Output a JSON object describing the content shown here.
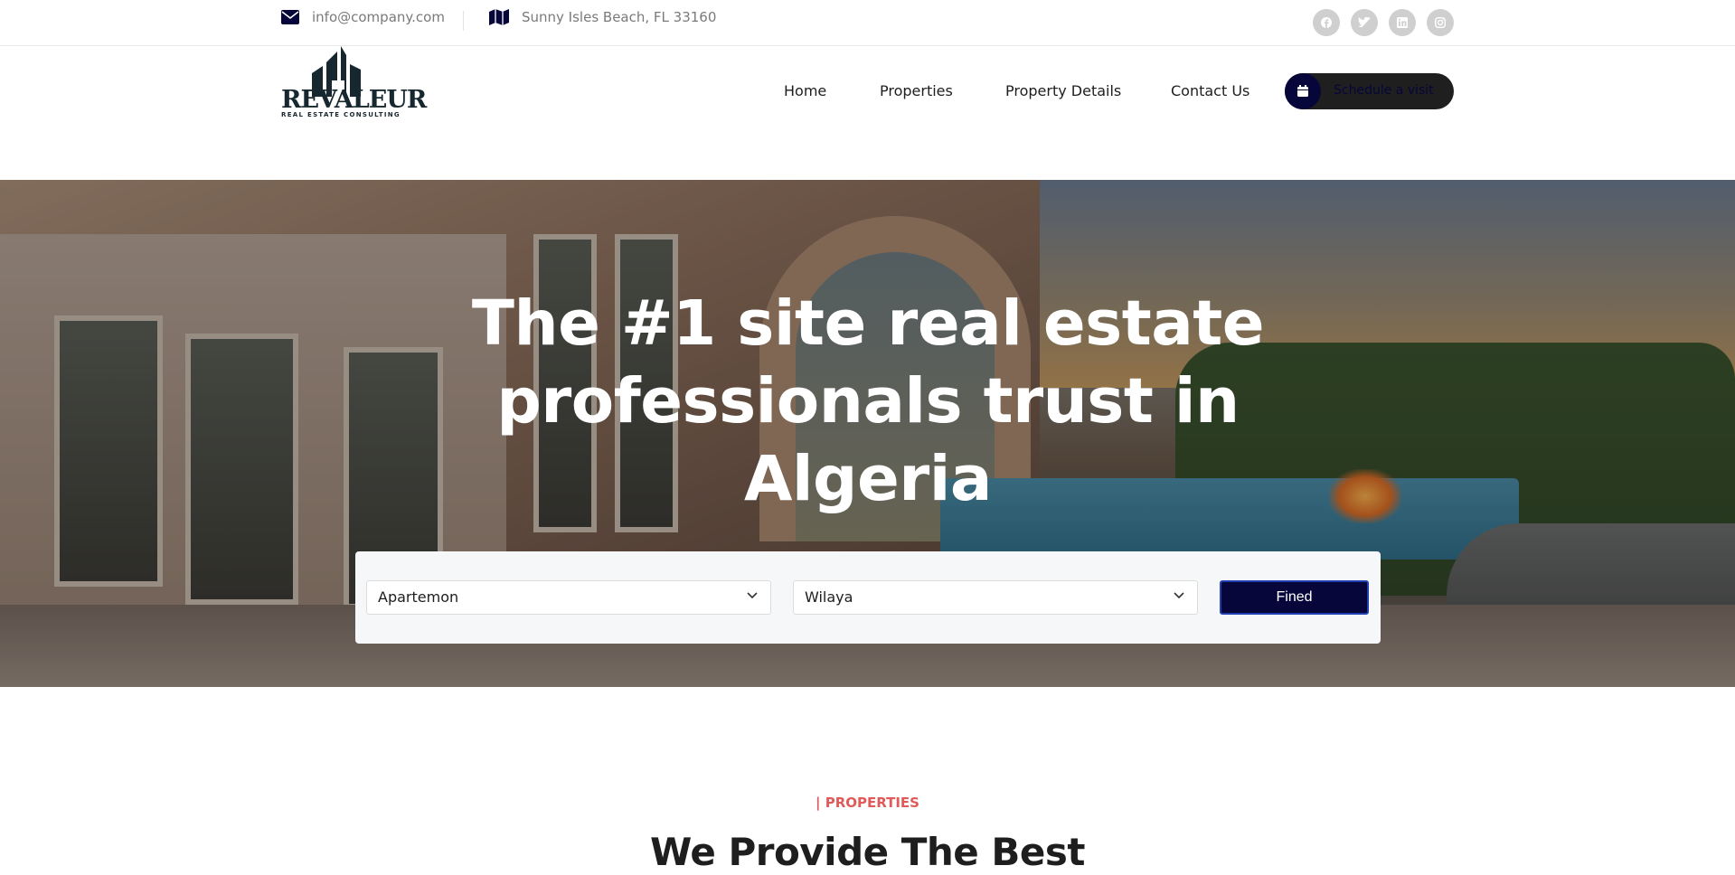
{
  "topbar": {
    "email": "info@company.com",
    "address": "Sunny Isles Beach, FL 33160",
    "socials": [
      "facebook-icon",
      "twitter-icon",
      "linkedin-icon",
      "instagram-icon"
    ]
  },
  "brand": {
    "logo_word": "REVALEUR",
    "logo_tagline": "REAL ESTATE CONSULTING",
    "primary_color": "#06063a",
    "accent_color": "#e05a5a"
  },
  "nav": {
    "items": [
      {
        "label": "Home",
        "active": true
      },
      {
        "label": "Properties",
        "active": false
      },
      {
        "label": "Property Details",
        "active": false
      },
      {
        "label": "Contact Us",
        "active": false
      }
    ],
    "cta_label": "Schedule a visit"
  },
  "hero": {
    "title": "The #1 site real estate professionals trust in Algeria"
  },
  "search": {
    "type_selected": "Apartemon",
    "wilaya_selected": "Wilaya",
    "button_label": "Fined"
  },
  "section": {
    "kicker": "| PROPERTIES",
    "title": "We Provide The Best"
  }
}
